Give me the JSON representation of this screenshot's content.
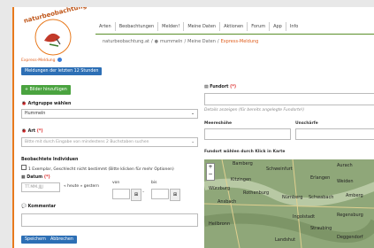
{
  "logo": {
    "text": "naturbeobachtung.at"
  },
  "nav": [
    "Arten",
    "Beobachtungen",
    "Melden!",
    "Meine Daten",
    "Aktionen",
    "Forum",
    "App",
    "Info"
  ],
  "crumb": {
    "home": "naturbeobachtung.at",
    "sep": "/",
    "user": "mummeln",
    "mydata": "Meine Daten",
    "current": "Express-Meldung"
  },
  "section_title": "Express-Meldung",
  "last_reports_button": "Meldungen der letzten 12 Stunden",
  "add_images_button": "+ Bilder hinzufügen",
  "group": {
    "label": "Artgruppe wählen",
    "value": "Hummeln"
  },
  "art": {
    "label": "Art",
    "placeholder": "Bitte mit durch Eingabe von mindestens 2 Buchstaben suchen"
  },
  "individuals": {
    "label": "Beobachtete Individuen",
    "option": "1 Exemplar, Geschlecht nicht bestimmt (Bitte klicken für mehr Optionen)"
  },
  "date": {
    "label": "Datum",
    "placeholder": "TT.MM.JJJJ",
    "today": "« heute » gestern",
    "from_label": "von",
    "to_label": "bis"
  },
  "comment": {
    "label": "Kommentar"
  },
  "save_button": "Speichern",
  "cancel_button": "Abbrechen",
  "location": {
    "label": "Fundort",
    "hint": "Details anzeigen (für bereits angelegte Fundorte!)",
    "height_label": "Meereshöhe",
    "accuracy_label": "Unschärfe",
    "map_label": "Fundort wählen durch Klick in Karte"
  },
  "map_places": [
    "Bamberg",
    "Aurach",
    "Schweinfurt",
    "Kitzingen",
    "Würzburg",
    "Rothenburg",
    "Ansbach",
    "Erlangen",
    "Nürnberg",
    "Schwabach",
    "Amberg",
    "Weiden",
    "Regensburg",
    "Ingolstadt",
    "Straubing",
    "Landshut",
    "Deggendorf",
    "Heilbronn"
  ],
  "colors": {
    "accent": "#e87a1e",
    "blue": "#2d6fb5",
    "green": "#4aa33f"
  }
}
